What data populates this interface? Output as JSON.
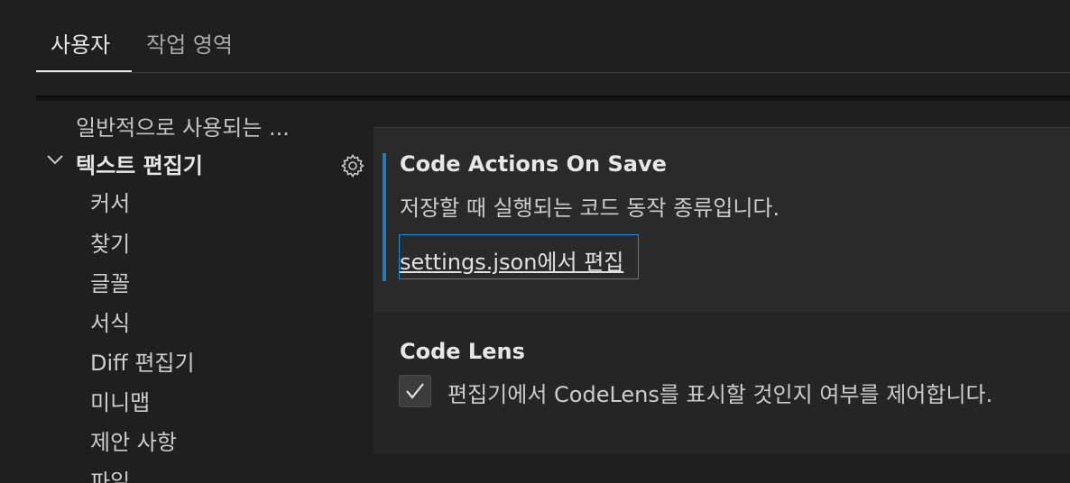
{
  "tabs": {
    "user": "사용자",
    "workspace": "작업 영역"
  },
  "toc": {
    "parent": "일반적으로 사용되는 ...",
    "group": "텍스트 편집기",
    "children": [
      "커서",
      "찾기",
      "글꼴",
      "서식",
      "Diff 편집기",
      "미니맵",
      "제안 사항",
      "파일"
    ]
  },
  "settings": {
    "code_actions": {
      "title": "Code Actions On Save",
      "description": "저장할 때 실행되는 코드 동작 종류입니다.",
      "link": "settings.json에서 편집"
    },
    "code_lens": {
      "title": "Code Lens",
      "description": "편집기에서 CodeLens를 표시할 것인지 여부를 제어합니다.",
      "checked": true
    }
  },
  "colors": {
    "accent": "#2a7ab0",
    "focus_border": "#1a8ad9",
    "background": "#1f1f1f"
  },
  "icons": {
    "group": "chevron-down-icon",
    "gear": "gear-icon",
    "check": "checkmark-icon"
  }
}
